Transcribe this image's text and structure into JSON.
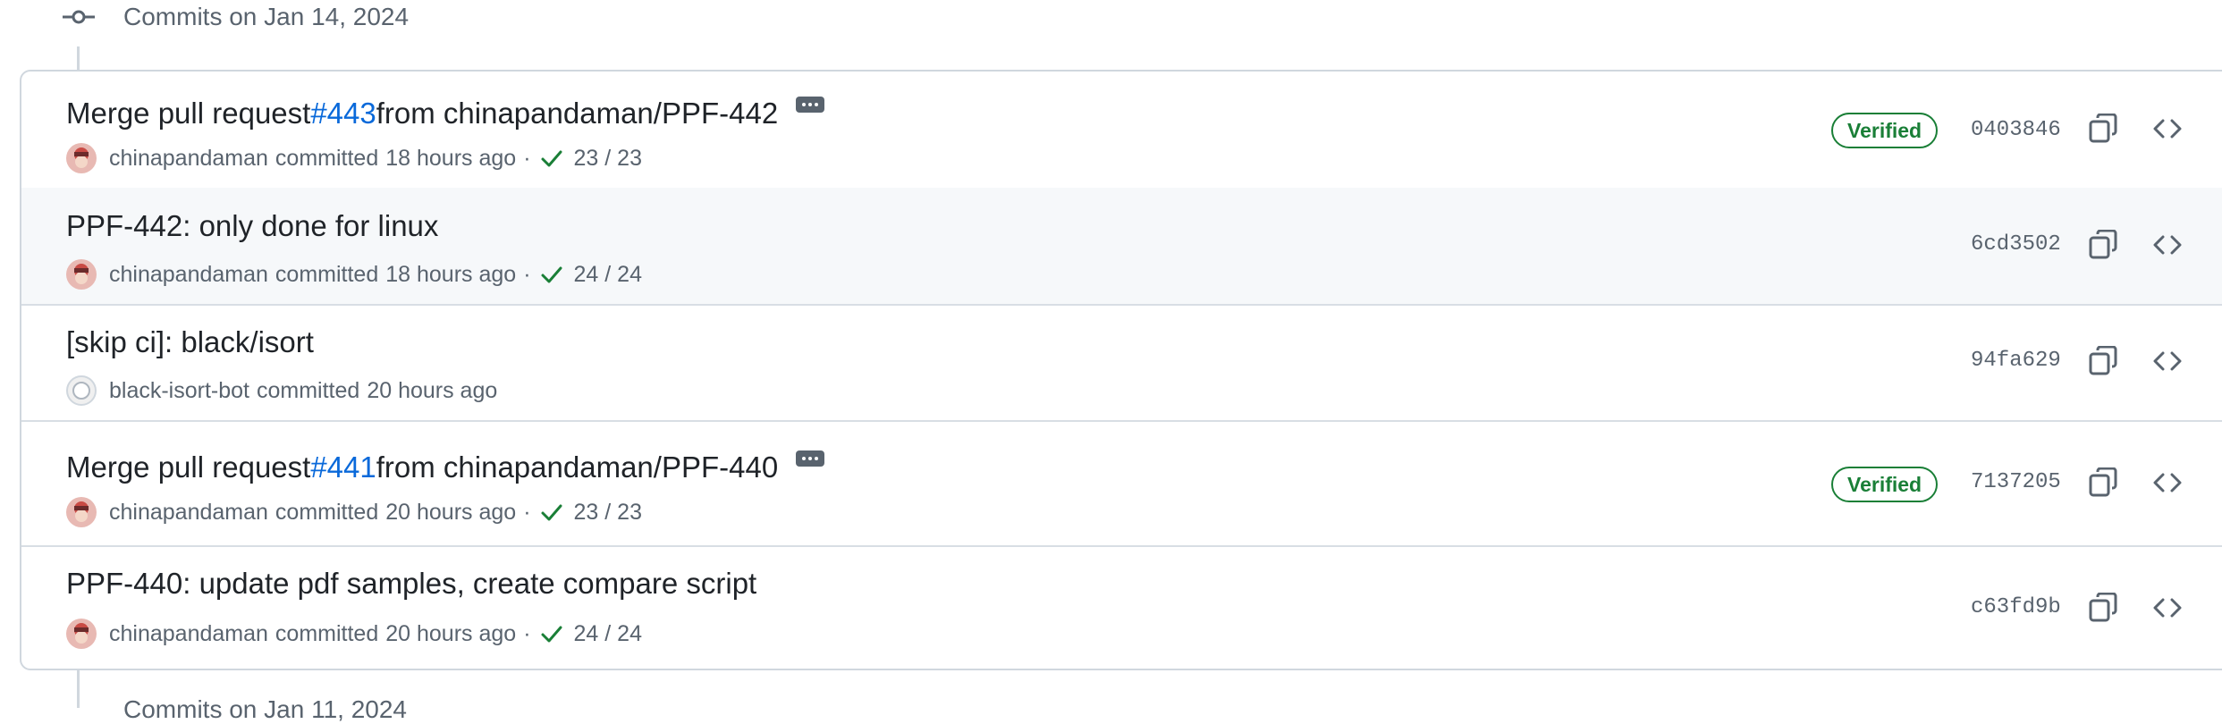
{
  "group": {
    "title": "Commits on Jan 14, 2024"
  },
  "next_group": {
    "title": "Commits on Jan 11, 2024"
  },
  "commits": [
    {
      "prefix": "Merge pull request ",
      "pr_link": "#443",
      "suffix": " from chinapandaman/PPF-442",
      "author": "chinapandaman",
      "action": "committed",
      "time": "18 hours ago",
      "separator": "·",
      "checks": "23 / 23",
      "verified": "Verified",
      "sha": "0403846"
    },
    {
      "message": "PPF-442: only done for linux",
      "author": "chinapandaman",
      "action": "committed",
      "time": "18 hours ago",
      "separator": "·",
      "checks": "24 / 24",
      "sha": "6cd3502"
    },
    {
      "message": "[skip ci]: black/isort",
      "author": "black-isort-bot",
      "action": "committed",
      "time": "20 hours ago",
      "sha": "94fa629"
    },
    {
      "prefix": "Merge pull request ",
      "pr_link": "#441",
      "suffix": " from chinapandaman/PPF-440",
      "author": "chinapandaman",
      "action": "committed",
      "time": "20 hours ago",
      "separator": "·",
      "checks": "23 / 23",
      "verified": "Verified",
      "sha": "7137205"
    },
    {
      "message": "PPF-440: update pdf samples, create compare script",
      "author": "chinapandaman",
      "action": "committed",
      "time": "20 hours ago",
      "separator": "·",
      "checks": "24 / 24",
      "sha": "c63fd9b"
    }
  ],
  "icons": {
    "commit": "git-commit-icon",
    "copy": "copy-icon",
    "browse": "code-icon",
    "check": "check-icon",
    "ellipsis": "kebab-horizontal-icon"
  },
  "colors": {
    "link": "#0969da",
    "verified": "#1a7f37",
    "muted": "#59636e",
    "border": "#d0d7de",
    "row_highlight": "#f6f8fa"
  }
}
